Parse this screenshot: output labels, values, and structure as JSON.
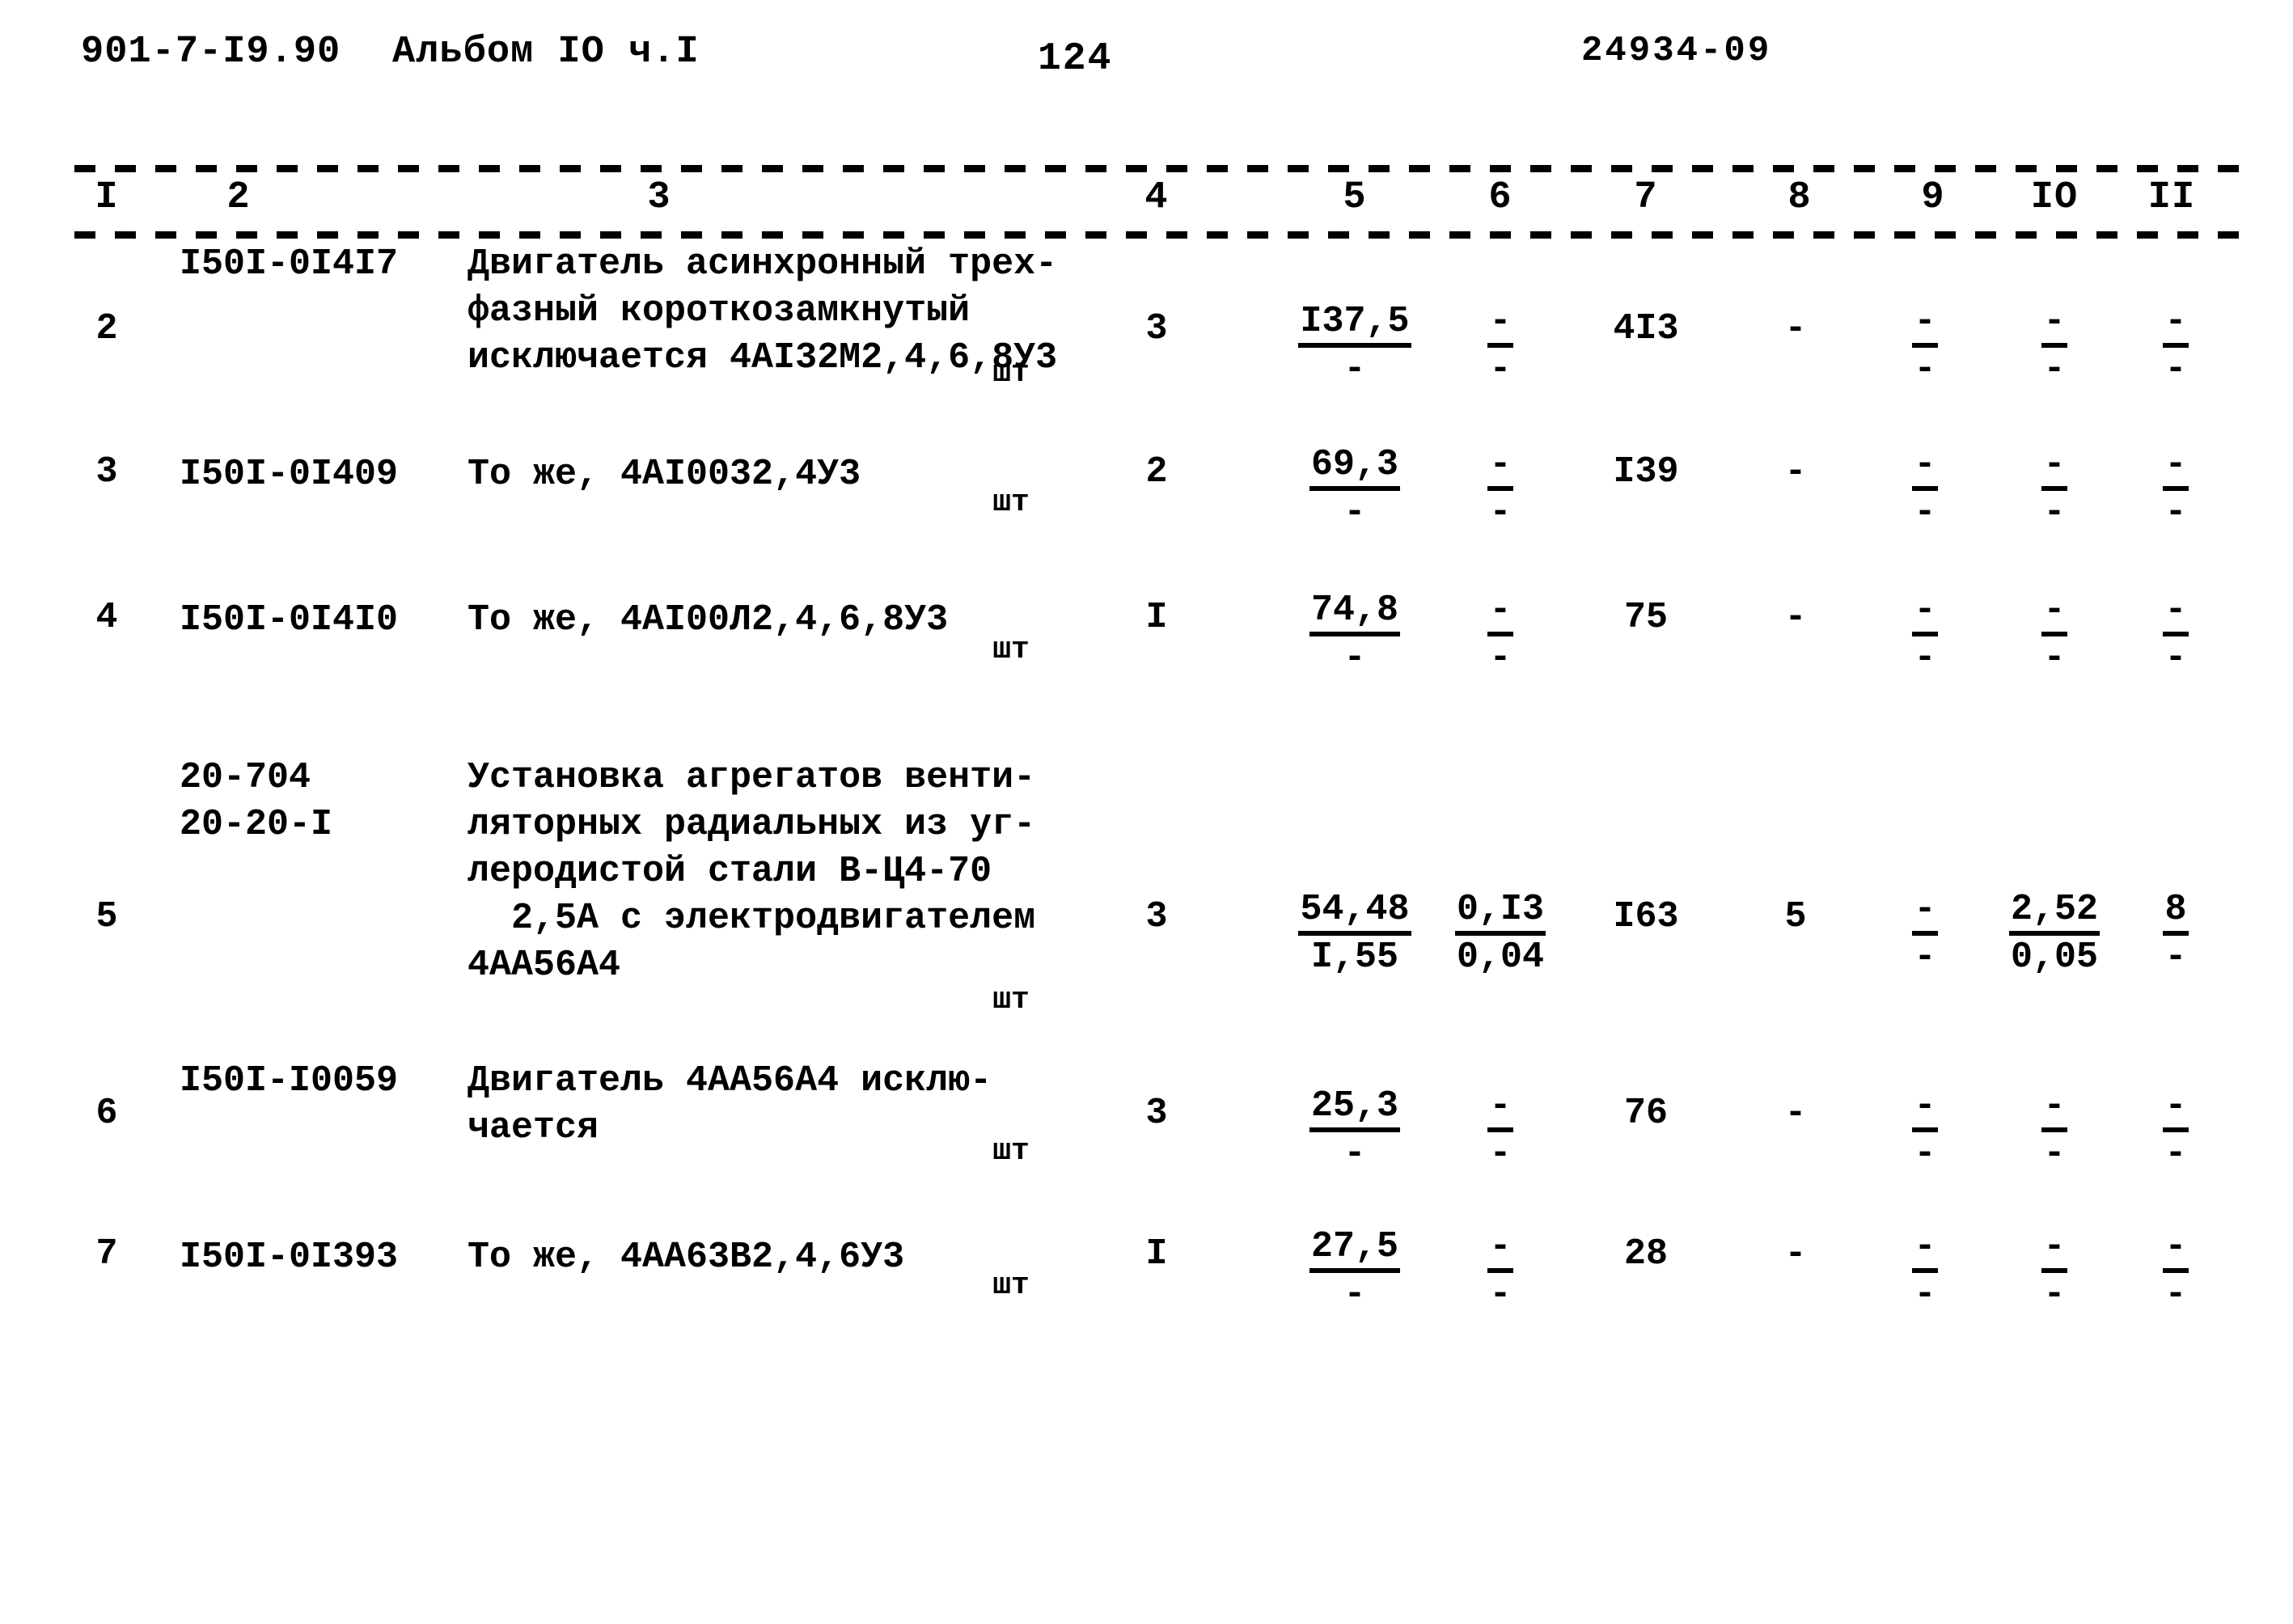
{
  "document": {
    "series_code": "901-7-I9.90",
    "album": "Альбом IO ч.I",
    "page_number": "124",
    "stamp": "24934-09"
  },
  "table": {
    "column_headers": [
      "I",
      "2",
      "3",
      "4",
      "5",
      "6",
      "7",
      "8",
      "9",
      "IO",
      "II"
    ],
    "rows": [
      {
        "num": "2",
        "code": "I50I-0I4I7",
        "desc": "Двигатель асинхронный трех-\nфазный короткозамкнутый\nисключается 4АI32М2,4,6,8У3",
        "unit": "шт",
        "c4": "3",
        "c5_num": "I37,5",
        "c5_den": "-",
        "c6_num": "-",
        "c6_den": "-",
        "c7": "4I3",
        "c8": "-",
        "c9_num": "-",
        "c9_den": "-",
        "c10_num": "-",
        "c10_den": "-",
        "c11_num": "-",
        "c11_den": "-"
      },
      {
        "num": "3",
        "code": "I50I-0I409",
        "desc": "То же, 4АI0032,4У3",
        "unit": "шт",
        "c4": "2",
        "c5_num": "69,3",
        "c5_den": "-",
        "c6_num": "-",
        "c6_den": "-",
        "c7": "I39",
        "c8": "-",
        "c9_num": "-",
        "c9_den": "-",
        "c10_num": "-",
        "c10_den": "-",
        "c11_num": "-",
        "c11_den": "-"
      },
      {
        "num": "4",
        "code": "I50I-0I4I0",
        "desc": "То же, 4АI00Л2,4,6,8У3",
        "unit": "шт",
        "c4": "I",
        "c5_num": "74,8",
        "c5_den": "-",
        "c6_num": "-",
        "c6_den": "-",
        "c7": "75",
        "c8": "-",
        "c9_num": "-",
        "c9_den": "-",
        "c10_num": "-",
        "c10_den": "-",
        "c11_num": "-",
        "c11_den": "-"
      },
      {
        "num": "5",
        "code": "20-704\n20-20-I",
        "desc": "Установка агрегатов венти-\nляторных радиальных из уг-\nлеродистой стали В-Ц4-70\n  2,5А с электродвигателем\n4АА56А4",
        "unit": "шт",
        "c4": "3",
        "c5_num": "54,48",
        "c5_den": "I,55",
        "c6_num": "0,I3",
        "c6_den": "0,04",
        "c7": "I63",
        "c8": "5",
        "c9_num": "-",
        "c9_den": "-",
        "c10_num": "2,52",
        "c10_den": "0,05",
        "c11_num": "8",
        "c11_den": "-"
      },
      {
        "num": "6",
        "code": "I50I-I0059",
        "desc": "Двигатель 4АА56А4 исклю-\nчается",
        "unit": "шт",
        "c4": "3",
        "c5_num": "25,3",
        "c5_den": "-",
        "c6_num": "-",
        "c6_den": "-",
        "c7": "76",
        "c8": "-",
        "c9_num": "-",
        "c9_den": "-",
        "c10_num": "-",
        "c10_den": "-",
        "c11_num": "-",
        "c11_den": "-"
      },
      {
        "num": "7",
        "code": "I50I-0I393",
        "desc": "То же, 4АА63В2,4,6У3",
        "unit": "шт",
        "c4": "I",
        "c5_num": "27,5",
        "c5_den": "-",
        "c6_num": "-",
        "c6_den": "-",
        "c7": "28",
        "c8": "-",
        "c9_num": "-",
        "c9_den": "-",
        "c10_num": "-",
        "c10_den": "-",
        "c11_num": "-",
        "c11_den": "-"
      }
    ]
  }
}
